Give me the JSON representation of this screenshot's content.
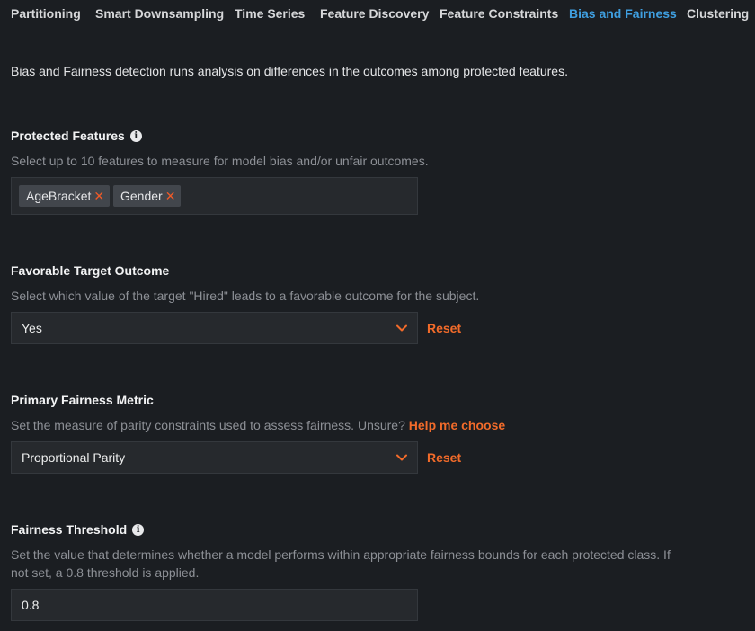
{
  "tabs": [
    {
      "label": "Partitioning",
      "active": false
    },
    {
      "label": "Smart Downsampling",
      "active": false
    },
    {
      "label": "Time Series",
      "active": false
    },
    {
      "label": "Feature Discovery",
      "active": false
    },
    {
      "label": "Feature Constraints",
      "active": false
    },
    {
      "label": "Bias and Fairness",
      "active": true
    },
    {
      "label": "Clustering",
      "active": false
    }
  ],
  "intro": "Bias and Fairness detection runs analysis on differences in the outcomes among protected features.",
  "protected_features": {
    "title": "Protected Features",
    "info_icon": "info-icon",
    "helper": "Select up to 10 features to measure for model bias and/or unfair outcomes.",
    "tags": [
      "AgeBracket",
      "Gender"
    ],
    "remove_glyph": "✕"
  },
  "favorable_outcome": {
    "title": "Favorable Target Outcome",
    "helper": "Select which value of the target \"Hired\" leads to a favorable outcome for the subject.",
    "value": "Yes",
    "reset_label": "Reset"
  },
  "primary_metric": {
    "title": "Primary Fairness Metric",
    "helper": "Set the measure of parity constraints used to assess fairness. Unsure?",
    "help_link": "Help me choose",
    "value": "Proportional Parity",
    "reset_label": "Reset"
  },
  "fairness_threshold": {
    "title": "Fairness Threshold",
    "info_icon": "info-icon",
    "helper_line1": "Set the value that determines whether a model performs within appropriate fairness bounds for each protected class. If",
    "helper_line2": "not set, a 0.8 threshold is applied.",
    "value": "0.8"
  },
  "colors": {
    "accent_blue": "#3f9fe0",
    "accent_orange": "#f26b2a",
    "background": "#1b1e22"
  }
}
